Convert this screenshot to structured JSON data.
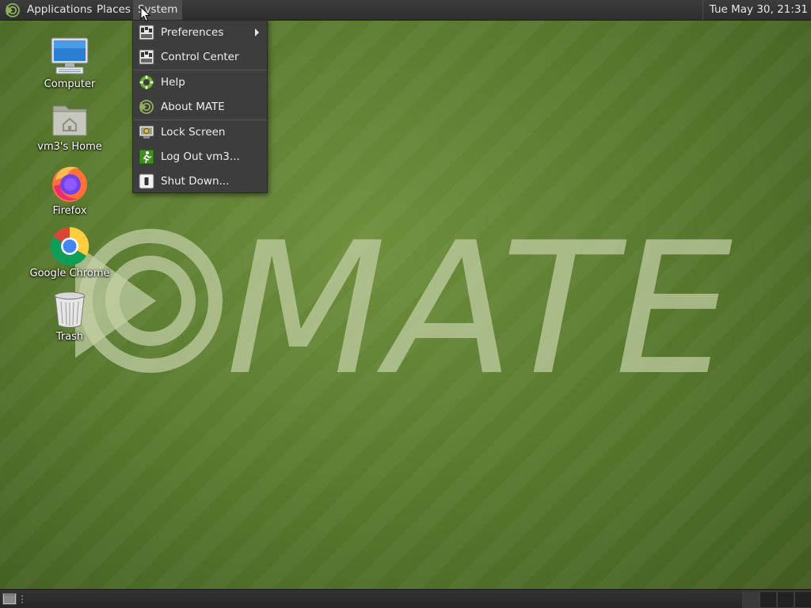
{
  "top_panel": {
    "menus": {
      "applications": "Applications",
      "places": "Places",
      "system": "System"
    },
    "clock": "Tue May 30, 21:31"
  },
  "desktop": {
    "icons": [
      {
        "label": "Computer",
        "icon": "computer-icon"
      },
      {
        "label": "vm3's Home",
        "icon": "home-folder-icon"
      },
      {
        "label": "Firefox",
        "icon": "firefox-icon"
      },
      {
        "label": "Google Chrome",
        "icon": "chrome-icon"
      },
      {
        "label": "Trash",
        "icon": "trash-icon"
      }
    ],
    "wallpaper_text": "MATE"
  },
  "system_menu": {
    "items": [
      {
        "label": "Preferences",
        "icon": "preferences-icon",
        "has_submenu": true
      },
      {
        "label": "Control Center",
        "icon": "control-center-icon"
      },
      {
        "label": "Help",
        "icon": "help-icon"
      },
      {
        "label": "About MATE",
        "icon": "mate-logo-icon"
      },
      {
        "label": "Lock Screen",
        "icon": "lock-screen-icon"
      },
      {
        "label": "Log Out vm3...",
        "icon": "log-out-icon"
      },
      {
        "label": "Shut Down...",
        "icon": "shut-down-icon"
      }
    ]
  },
  "colors": {
    "panel": "#2f2f2f",
    "menu_bg": "#3d3d3d",
    "wallpaper_green": "#5f8033"
  }
}
